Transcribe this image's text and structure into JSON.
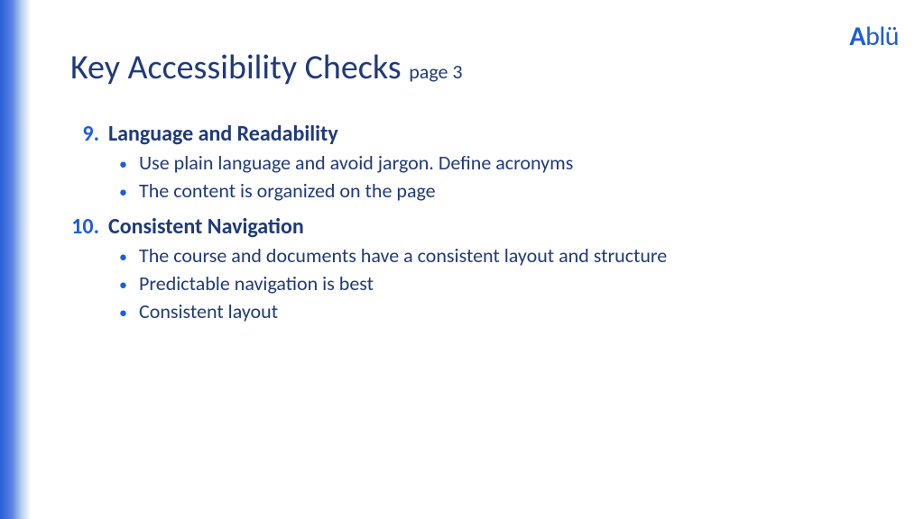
{
  "logo": "Ablü",
  "title": "Key Accessibility Checks",
  "title_sub": "page 3",
  "items": [
    {
      "num": "9.",
      "title": "Language and Readability",
      "subs": [
        "Use plain language and avoid jargon. Define acronyms",
        "The content is organized on the page"
      ]
    },
    {
      "num": "10.",
      "title": "Consistent Navigation",
      "subs": [
        "The course and documents have a consistent layout and structure",
        "Predictable navigation is best",
        "Consistent layout"
      ]
    }
  ]
}
